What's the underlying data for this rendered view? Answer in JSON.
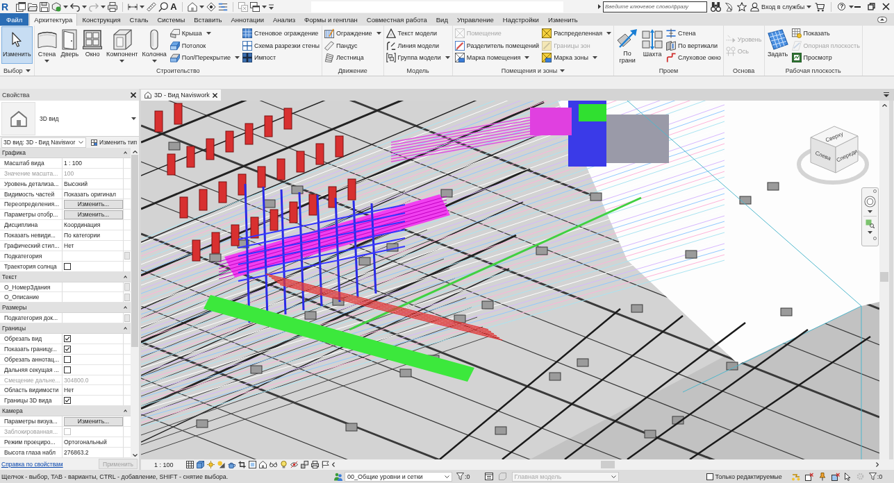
{
  "title_bar": {
    "logo": "R",
    "text_tool": "A",
    "search": {
      "placeholder": "Введите ключевое слово/фразу"
    },
    "sign_in": "Вход в службы",
    "help": "?"
  },
  "ribbon_tabs": [
    {
      "label": "Файл",
      "kind": "file",
      "selected": false
    },
    {
      "label": "Архитектура",
      "kind": "tab",
      "selected": true
    },
    {
      "label": "Конструкция",
      "kind": "tab",
      "selected": false
    },
    {
      "label": "Сталь",
      "kind": "tab",
      "selected": false
    },
    {
      "label": "Системы",
      "kind": "tab",
      "selected": false
    },
    {
      "label": "Вставить",
      "kind": "tab",
      "selected": false
    },
    {
      "label": "Аннотации",
      "kind": "tab",
      "selected": false
    },
    {
      "label": "Анализ",
      "kind": "tab",
      "selected": false
    },
    {
      "label": "Формы и генплан",
      "kind": "tab",
      "selected": false
    },
    {
      "label": "Совместная работа",
      "kind": "tab",
      "selected": false
    },
    {
      "label": "Вид",
      "kind": "tab",
      "selected": false
    },
    {
      "label": "Управление",
      "kind": "tab",
      "selected": false
    },
    {
      "label": "Надстройки",
      "kind": "tab",
      "selected": false
    },
    {
      "label": "Изменить",
      "kind": "tab",
      "selected": false
    }
  ],
  "ribbon_panels": [
    {
      "title": "Выбор",
      "menu": true,
      "groups": [
        {
          "kind": "large",
          "label": "Изменить",
          "dropdown": false,
          "selected": true
        }
      ]
    },
    {
      "title": "Строительство",
      "menu": false,
      "groups": [
        {
          "kind": "large",
          "label": "Стена",
          "dropdown": true,
          "selected": false
        },
        {
          "kind": "large",
          "label": "Дверь",
          "dropdown": false,
          "selected": false
        },
        {
          "kind": "large",
          "label": "Окно",
          "dropdown": false,
          "selected": false
        },
        {
          "kind": "large",
          "label": "Компонент",
          "dropdown": true,
          "selected": false
        },
        {
          "kind": "large",
          "label": "Колонна",
          "dropdown": true,
          "selected": false
        },
        {
          "kind": "stack",
          "items": [
            {
              "label": "Крыша",
              "dropdown": true,
              "disabled": false
            },
            {
              "label": "Потолок",
              "dropdown": false,
              "disabled": false
            },
            {
              "label": "Пол/Перекрытие",
              "dropdown": true,
              "disabled": false
            }
          ]
        },
        {
          "kind": "stack",
          "items": [
            {
              "label": "Стеновое ограждение",
              "dropdown": false,
              "disabled": false
            },
            {
              "label": "Схема разрезки стены",
              "dropdown": false,
              "disabled": false
            },
            {
              "label": "Импост",
              "dropdown": false,
              "disabled": false
            }
          ]
        }
      ]
    },
    {
      "title": "Движение",
      "menu": false,
      "groups": [
        {
          "kind": "stack",
          "items": [
            {
              "label": "Ограждение",
              "dropdown": true,
              "disabled": false
            },
            {
              "label": "Пандус",
              "dropdown": false,
              "disabled": false
            },
            {
              "label": "Лестница",
              "dropdown": false,
              "disabled": false
            }
          ]
        }
      ]
    },
    {
      "title": "Модель",
      "menu": false,
      "groups": [
        {
          "kind": "stack",
          "items": [
            {
              "label": "Текст модели",
              "dropdown": false,
              "disabled": false
            },
            {
              "label": "Линия модели",
              "dropdown": false,
              "disabled": false
            },
            {
              "label": "Группа модели",
              "dropdown": true,
              "disabled": false
            }
          ]
        }
      ]
    },
    {
      "title": "Помещения и зоны",
      "menu": true,
      "groups": [
        {
          "kind": "stack",
          "items": [
            {
              "label": "Помещение",
              "dropdown": false,
              "disabled": true
            },
            {
              "label": "Разделитель помещений",
              "dropdown": false,
              "disabled": false
            },
            {
              "label": "Марка помещения",
              "dropdown": true,
              "disabled": false
            }
          ]
        },
        {
          "kind": "stack",
          "items": [
            {
              "label": "Распределенная",
              "dropdown": true,
              "disabled": false
            },
            {
              "label": "Границы зон",
              "dropdown": false,
              "disabled": true
            },
            {
              "label": "Марка зоны",
              "dropdown": true,
              "disabled": false
            }
          ]
        }
      ]
    },
    {
      "title": "Проем",
      "menu": false,
      "groups": [
        {
          "kind": "large",
          "label": "По\nграни",
          "dropdown": false,
          "selected": false
        },
        {
          "kind": "large",
          "label": "Шахта",
          "dropdown": false,
          "selected": false
        },
        {
          "kind": "stack",
          "items": [
            {
              "label": "Стена",
              "dropdown": false,
              "disabled": false
            },
            {
              "label": "По вертикали",
              "dropdown": false,
              "disabled": false
            },
            {
              "label": "Слуховое окно",
              "dropdown": false,
              "disabled": false
            }
          ]
        }
      ]
    },
    {
      "title": "Основа",
      "menu": false,
      "groups": [
        {
          "kind": "stack",
          "items": [
            {
              "label": "Уровень",
              "dropdown": false,
              "disabled": true
            },
            {
              "label": "Ось",
              "dropdown": false,
              "disabled": true
            }
          ]
        }
      ]
    },
    {
      "title": "Рабочая плоскость",
      "menu": false,
      "groups": [
        {
          "kind": "large",
          "label": "Задать",
          "dropdown": false,
          "selected": false
        },
        {
          "kind": "stack",
          "items": [
            {
              "label": "Показать",
              "dropdown": false,
              "disabled": false
            },
            {
              "label": "Опорная плоскость",
              "dropdown": false,
              "disabled": true
            },
            {
              "label": "Просмотр",
              "dropdown": false,
              "disabled": false
            }
          ]
        }
      ]
    }
  ],
  "properties": {
    "title": "Свойства",
    "type_name": "3D вид",
    "instance": "3D вид: 3D - Вид Naviswor",
    "edit_type": "Изменить тип",
    "categories": [
      {
        "name": "Графика",
        "expanded": true,
        "rows": [
          {
            "label": "Масштаб вида",
            "kind": "text",
            "value": "1 : 100",
            "disabled": false,
            "linkable": false
          },
          {
            "label": "Значение масшта...",
            "kind": "text",
            "value": "100",
            "disabled": true,
            "linkable": false
          },
          {
            "label": "Уровень детализа...",
            "kind": "text",
            "value": "Высокий",
            "disabled": false,
            "linkable": false
          },
          {
            "label": "Видимость частей",
            "kind": "text",
            "value": "Показать оригинал",
            "disabled": false,
            "linkable": false
          },
          {
            "label": "Переопределения...",
            "kind": "button",
            "value": "Изменить...",
            "disabled": false,
            "linkable": false
          },
          {
            "label": "Параметры отобр...",
            "kind": "button",
            "value": "Изменить...",
            "disabled": false,
            "linkable": false
          },
          {
            "label": "Дисциплина",
            "kind": "text",
            "value": "Координация",
            "disabled": false,
            "linkable": false
          },
          {
            "label": "Показать невиди...",
            "kind": "text",
            "value": "По категории",
            "disabled": false,
            "linkable": false
          },
          {
            "label": "Графический стил...",
            "kind": "text",
            "value": "Нет",
            "disabled": false,
            "linkable": false
          },
          {
            "label": "Подкатегория",
            "kind": "text",
            "disabled": false,
            "linkable": true
          },
          {
            "label": "Траектория солнца",
            "kind": "checkbox",
            "checked": false,
            "disabled": false,
            "linkable": false
          }
        ]
      },
      {
        "name": "Текст",
        "expanded": true,
        "rows": [
          {
            "label": "О_НомерЗдания",
            "kind": "text",
            "disabled": false,
            "linkable": true
          },
          {
            "label": "О_Описание",
            "kind": "text",
            "disabled": false,
            "linkable": true
          }
        ]
      },
      {
        "name": "Размеры",
        "expanded": true,
        "rows": [
          {
            "label": "Подкатегория док...",
            "kind": "text",
            "disabled": false,
            "linkable": true
          }
        ]
      },
      {
        "name": "Границы",
        "expanded": true,
        "rows": [
          {
            "label": "Обрезать вид",
            "kind": "checkbox",
            "checked": true,
            "disabled": false,
            "linkable": false
          },
          {
            "label": "Показать границу...",
            "kind": "checkbox",
            "checked": true,
            "disabled": false,
            "linkable": false
          },
          {
            "label": "Обрезать аннотац...",
            "kind": "checkbox",
            "checked": false,
            "disabled": false,
            "linkable": false
          },
          {
            "label": "Дальняя секущая ...",
            "kind": "checkbox",
            "checked": false,
            "disabled": false,
            "linkable": false
          },
          {
            "label": "Смещение дальне...",
            "kind": "text",
            "value": "304800.0",
            "disabled": true,
            "linkable": false
          },
          {
            "label": "Область видимости",
            "kind": "text",
            "value": "Нет",
            "disabled": false,
            "linkable": false
          },
          {
            "label": "Границы 3D вида",
            "kind": "checkbox",
            "checked": true,
            "disabled": false,
            "linkable": false
          }
        ]
      },
      {
        "name": "Камера",
        "expanded": true,
        "rows": [
          {
            "label": "Параметры визуа...",
            "kind": "button",
            "value": "Изменить...",
            "disabled": false,
            "linkable": false
          },
          {
            "label": "Заблокированная...",
            "kind": "checkbox",
            "checked": false,
            "disabled": true,
            "linkable": false
          },
          {
            "label": "Режим проециро...",
            "kind": "text",
            "value": "Ортогональный",
            "disabled": false,
            "linkable": false
          },
          {
            "label": "Высота глаза набл",
            "kind": "text",
            "value": "276863.2",
            "disabled": false,
            "linkable": false
          }
        ]
      }
    ],
    "help_link": "Справка по свойствам",
    "apply": {
      "label": "Применить",
      "disabled": true
    }
  },
  "view_tabs": [
    {
      "label": "3D - Вид Naviswork",
      "selected": true
    }
  ],
  "view_cube": {
    "faces": [
      "Сверху",
      "Слева",
      "Спереди"
    ]
  },
  "view_controls": {
    "scale": "1 : 100"
  },
  "status_bar": {
    "hint": "Щелчок - выбор, TAB - варианты, CTRL - добавление, SHIFT - снятие выбора.",
    "workset": "00_Общие уровни и сетки",
    "workset_filter": ":0",
    "design_option": {
      "value": "Главная модель",
      "disabled": true
    },
    "editable_only": {
      "label": "Только редактируемые",
      "checked": false
    },
    "selection_filter": ":0"
  }
}
